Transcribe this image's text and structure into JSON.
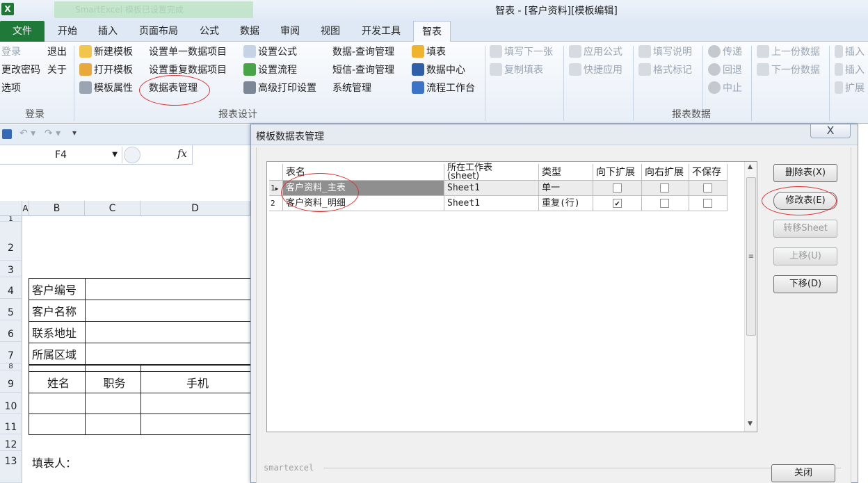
{
  "window": {
    "title": "智表 - [客户资料][模板编辑]",
    "notification": "SmartExcel 模板已设置完成"
  },
  "tabs": [
    "文件",
    "开始",
    "插入",
    "页面布局",
    "公式",
    "数据",
    "审阅",
    "视图",
    "开发工具",
    "智表"
  ],
  "ribbon": {
    "login_group": {
      "label": "登录",
      "items": [
        "登录",
        "退出",
        "更改密码",
        "关于",
        "选项"
      ]
    },
    "design_group": {
      "label": "报表设计",
      "col1": [
        "新建模板",
        "打开模板",
        "模板属性"
      ],
      "col2": [
        "设置单一数据项目",
        "设置重复数据项目",
        "数据表管理"
      ],
      "col3": [
        "设置公式",
        "设置流程",
        "高级打印设置"
      ],
      "col4": [
        "数据-查询管理",
        "短信-查询管理",
        "系统管理"
      ],
      "col5": [
        "填表",
        "数据中心",
        "流程工作台"
      ]
    },
    "data_group": {
      "label": "报表数据",
      "col1": [
        "填写下一张",
        "复制填表"
      ],
      "col2": [
        "应用公式",
        "快捷应用"
      ],
      "col3": [
        "填写说明",
        "格式标记"
      ],
      "col4": [
        "传递",
        "回退",
        "中止"
      ],
      "col5": [
        "上一份数据",
        "下一份数据"
      ],
      "col6": [
        "插入",
        "插入",
        "扩展"
      ]
    }
  },
  "formula_bar": {
    "cell_ref": "F4",
    "fx": "fx"
  },
  "sheet": {
    "columns": [
      "A",
      "B",
      "C",
      "D"
    ],
    "rows": [
      "1",
      "2",
      "3",
      "4",
      "5",
      "6",
      "7",
      "8",
      "9",
      "10",
      "11",
      "12",
      "13"
    ],
    "labels": [
      "客户编号",
      "客户名称",
      "联系地址",
      "所属区域"
    ],
    "detail_headers": [
      "姓名",
      "职务",
      "手机"
    ],
    "footer": "填表人："
  },
  "dialog": {
    "title": "模板数据表管理",
    "close_glyph": "X",
    "columns": [
      "表名",
      "所在工作表\n(sheet)",
      "类型",
      "向下扩展",
      "向右扩展",
      "不保存"
    ],
    "rows": [
      {
        "num": "1",
        "name": "客户资料_主表",
        "sheet": "Sheet1",
        "type": "单一",
        "down": false,
        "right": false,
        "nosave": false
      },
      {
        "num": "2",
        "name": "客户资料_明细",
        "sheet": "Sheet1",
        "type": "重复(行)",
        "down": true,
        "right": false,
        "nosave": false
      }
    ],
    "buttons": {
      "delete": "删除表(X)",
      "modify": "修改表(E)",
      "to_sheet": "转移Sheet",
      "up": "上移(U)",
      "down": "下移(D)",
      "close": "关闭"
    },
    "footer_label": "smartexcel"
  }
}
